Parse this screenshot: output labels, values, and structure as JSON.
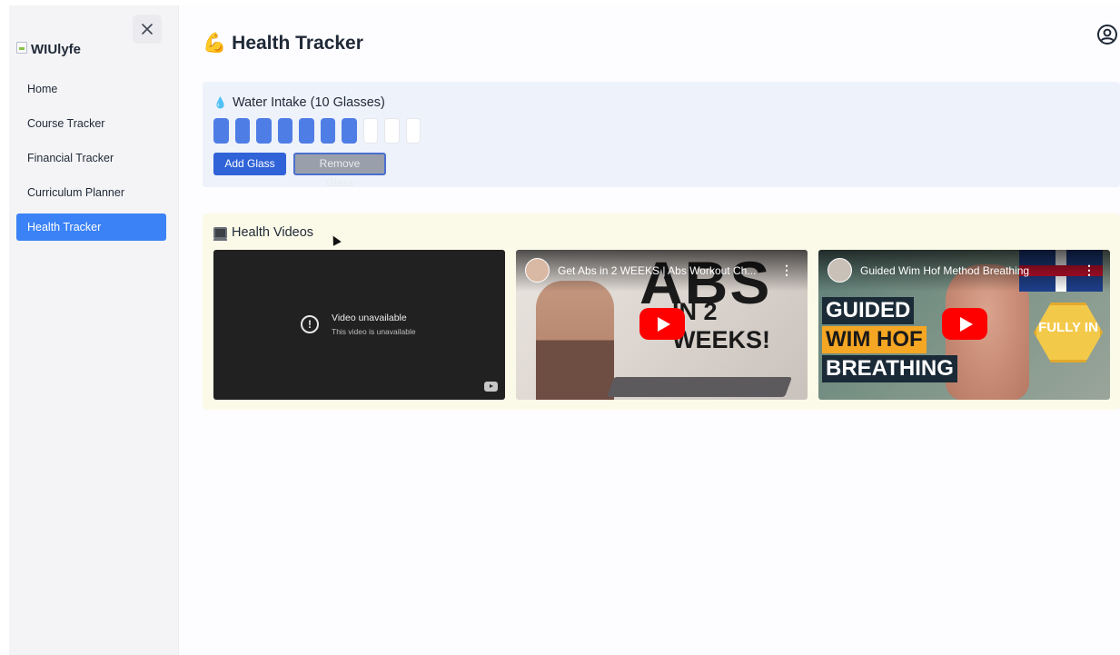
{
  "app": {
    "brand": "WIUlyfe"
  },
  "sidebar": {
    "items": [
      {
        "label": "Home",
        "active": false
      },
      {
        "label": "Course Tracker",
        "active": false
      },
      {
        "label": "Financial Tracker",
        "active": false
      },
      {
        "label": "Curriculum Planner",
        "active": false
      },
      {
        "label": "Health Tracker",
        "active": true
      }
    ]
  },
  "header": {
    "title_icon": "💪",
    "title": "Health Tracker"
  },
  "water": {
    "title_icon": "💧",
    "title": "Water Intake (10 Glasses)",
    "total_glasses": 10,
    "filled_glasses": 7,
    "add_label": "Add Glass",
    "remove_label": "Remove Glass"
  },
  "videos": {
    "title": "Health Videos",
    "items": [
      {
        "status": "unavailable",
        "message": "Video unavailable",
        "submessage": "This video is unavailable"
      },
      {
        "status": "available",
        "title": "Get Abs in 2 WEEKS | Abs Workout Ch...",
        "thumb_text": "ABS",
        "thumb_subtext": "IN 2 WEEKS!"
      },
      {
        "status": "available",
        "title": "Guided Wim Hof Method Breathing",
        "thumb_lines": [
          "GUIDED",
          "WIM HOF",
          "BREATHING"
        ],
        "badge": "FULLY IN"
      }
    ]
  },
  "colors": {
    "accent": "#3b82f6",
    "primary_button": "#2f63d7",
    "glass_filled": "#4f7de6",
    "youtube_red": "#ff0000"
  }
}
